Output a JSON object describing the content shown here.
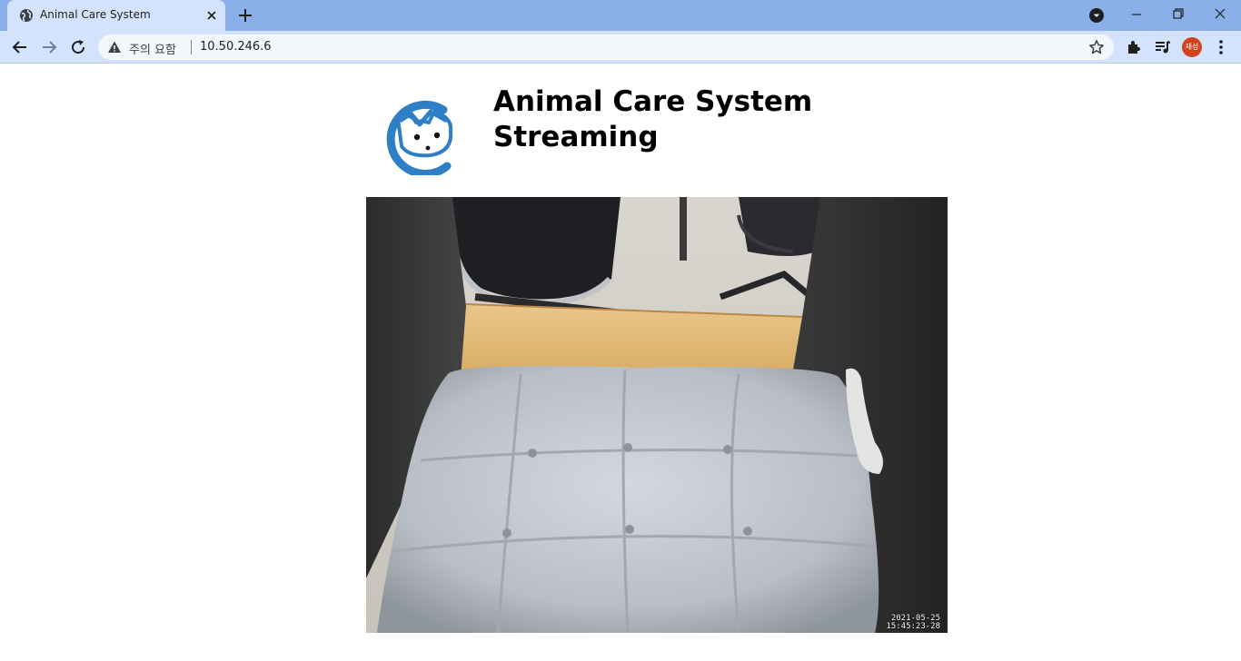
{
  "browser": {
    "tab_title": "Animal Care System",
    "warning_text": "주의 요함",
    "url": "10.50.246.6",
    "profile_initials": "재성"
  },
  "page": {
    "title_line1": "Animal Care System",
    "title_line2": "Streaming"
  },
  "stream": {
    "date": "2021-05-25",
    "time": "15:45:23-28"
  },
  "icons": {
    "tab_favicon": "globe-icon",
    "tab_close": "close-icon",
    "new_tab": "plus-icon",
    "tab_search": "chevron-down-circle-icon",
    "window_controls": [
      "minimize-icon",
      "restore-icon",
      "close-icon"
    ],
    "nav": [
      "back-arrow-icon",
      "forward-arrow-icon",
      "reload-icon"
    ],
    "address_warning": "warning-triangle-icon",
    "bookmark": "star-icon",
    "extensions": "puzzle-icon",
    "media": "playlist-icon",
    "menu": "kebab-menu-icon",
    "logo": "cat-logo-icon"
  },
  "colors": {
    "tabstrip": "#8aafe9",
    "toolbar": "#d3e3fd",
    "avatar": "#d1421f",
    "logo_blue": "#2f7fc6"
  }
}
